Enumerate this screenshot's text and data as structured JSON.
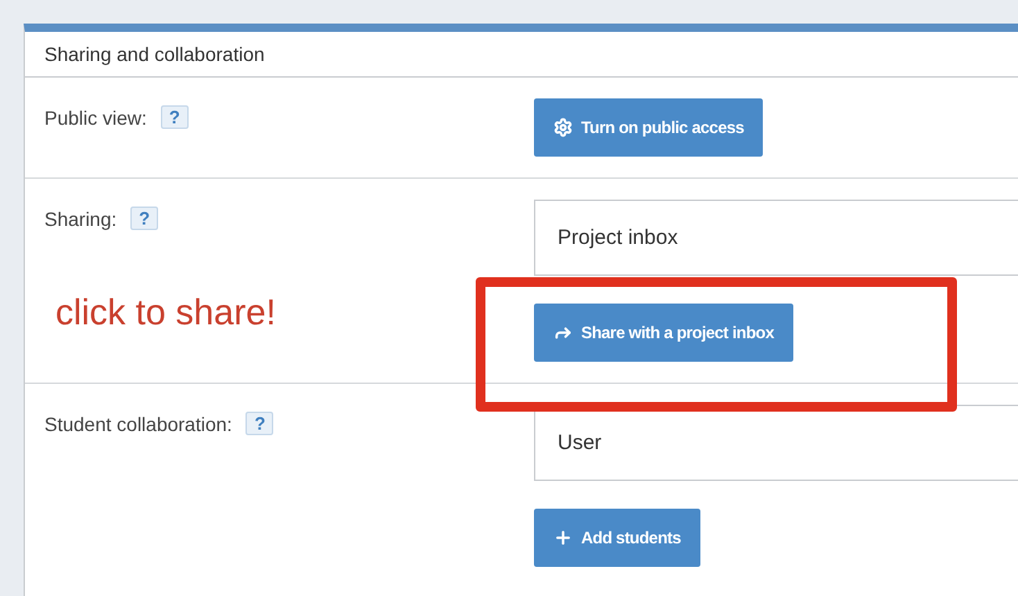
{
  "panel": {
    "title": "Sharing and collaboration"
  },
  "rows": [
    {
      "label": "Public view:",
      "help": "?",
      "buttons": [
        {
          "label": "Turn on public access"
        }
      ]
    },
    {
      "label": "Sharing:",
      "help": "?",
      "field": {
        "value": "Project inbox"
      },
      "note": "click to share!",
      "buttons": [
        {
          "label": "Share with a project inbox",
          "highlighted": true
        }
      ]
    },
    {
      "label": "Student collaboration:",
      "help": "?",
      "field": {
        "value": "User"
      },
      "buttons": [
        {
          "label": "Add students"
        }
      ]
    }
  ]
}
